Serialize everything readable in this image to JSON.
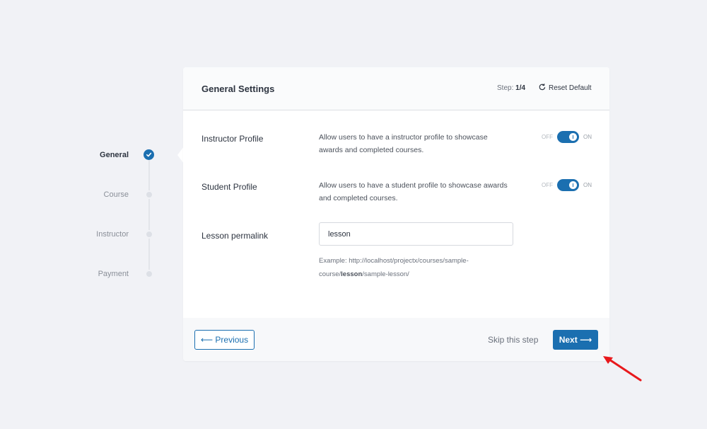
{
  "stepper": {
    "steps": [
      {
        "label": "General",
        "state": "complete"
      },
      {
        "label": "Course",
        "state": "pending"
      },
      {
        "label": "Instructor",
        "state": "pending"
      },
      {
        "label": "Payment",
        "state": "pending"
      }
    ]
  },
  "header": {
    "title": "General Settings",
    "step_prefix": "Step:",
    "step_value": "1/4",
    "reset_label": "Reset Default"
  },
  "settings": {
    "instructor_profile": {
      "label": "Instructor Profile",
      "description": "Allow users to have a instructor profile to showcase awards and completed courses.",
      "off_text": "OFF",
      "on_text": "ON",
      "enabled": true
    },
    "student_profile": {
      "label": "Student Profile",
      "description": "Allow users to have a student profile to showcase awards and completed courses.",
      "off_text": "OFF",
      "on_text": "ON",
      "enabled": true
    },
    "lesson_permalink": {
      "label": "Lesson permalink",
      "value": "lesson",
      "example_prefix": "Example: http://localhost/projectx/courses/sample-course/",
      "example_bold": "lesson",
      "example_suffix": "/sample-lesson/"
    }
  },
  "footer": {
    "previous_label": "⟵ Previous",
    "skip_label": "Skip this step",
    "next_label": "Next ⟶"
  },
  "colors": {
    "accent": "#1b6fb0",
    "background": "#f1f2f6",
    "annotation_arrow": "#e8191c"
  }
}
